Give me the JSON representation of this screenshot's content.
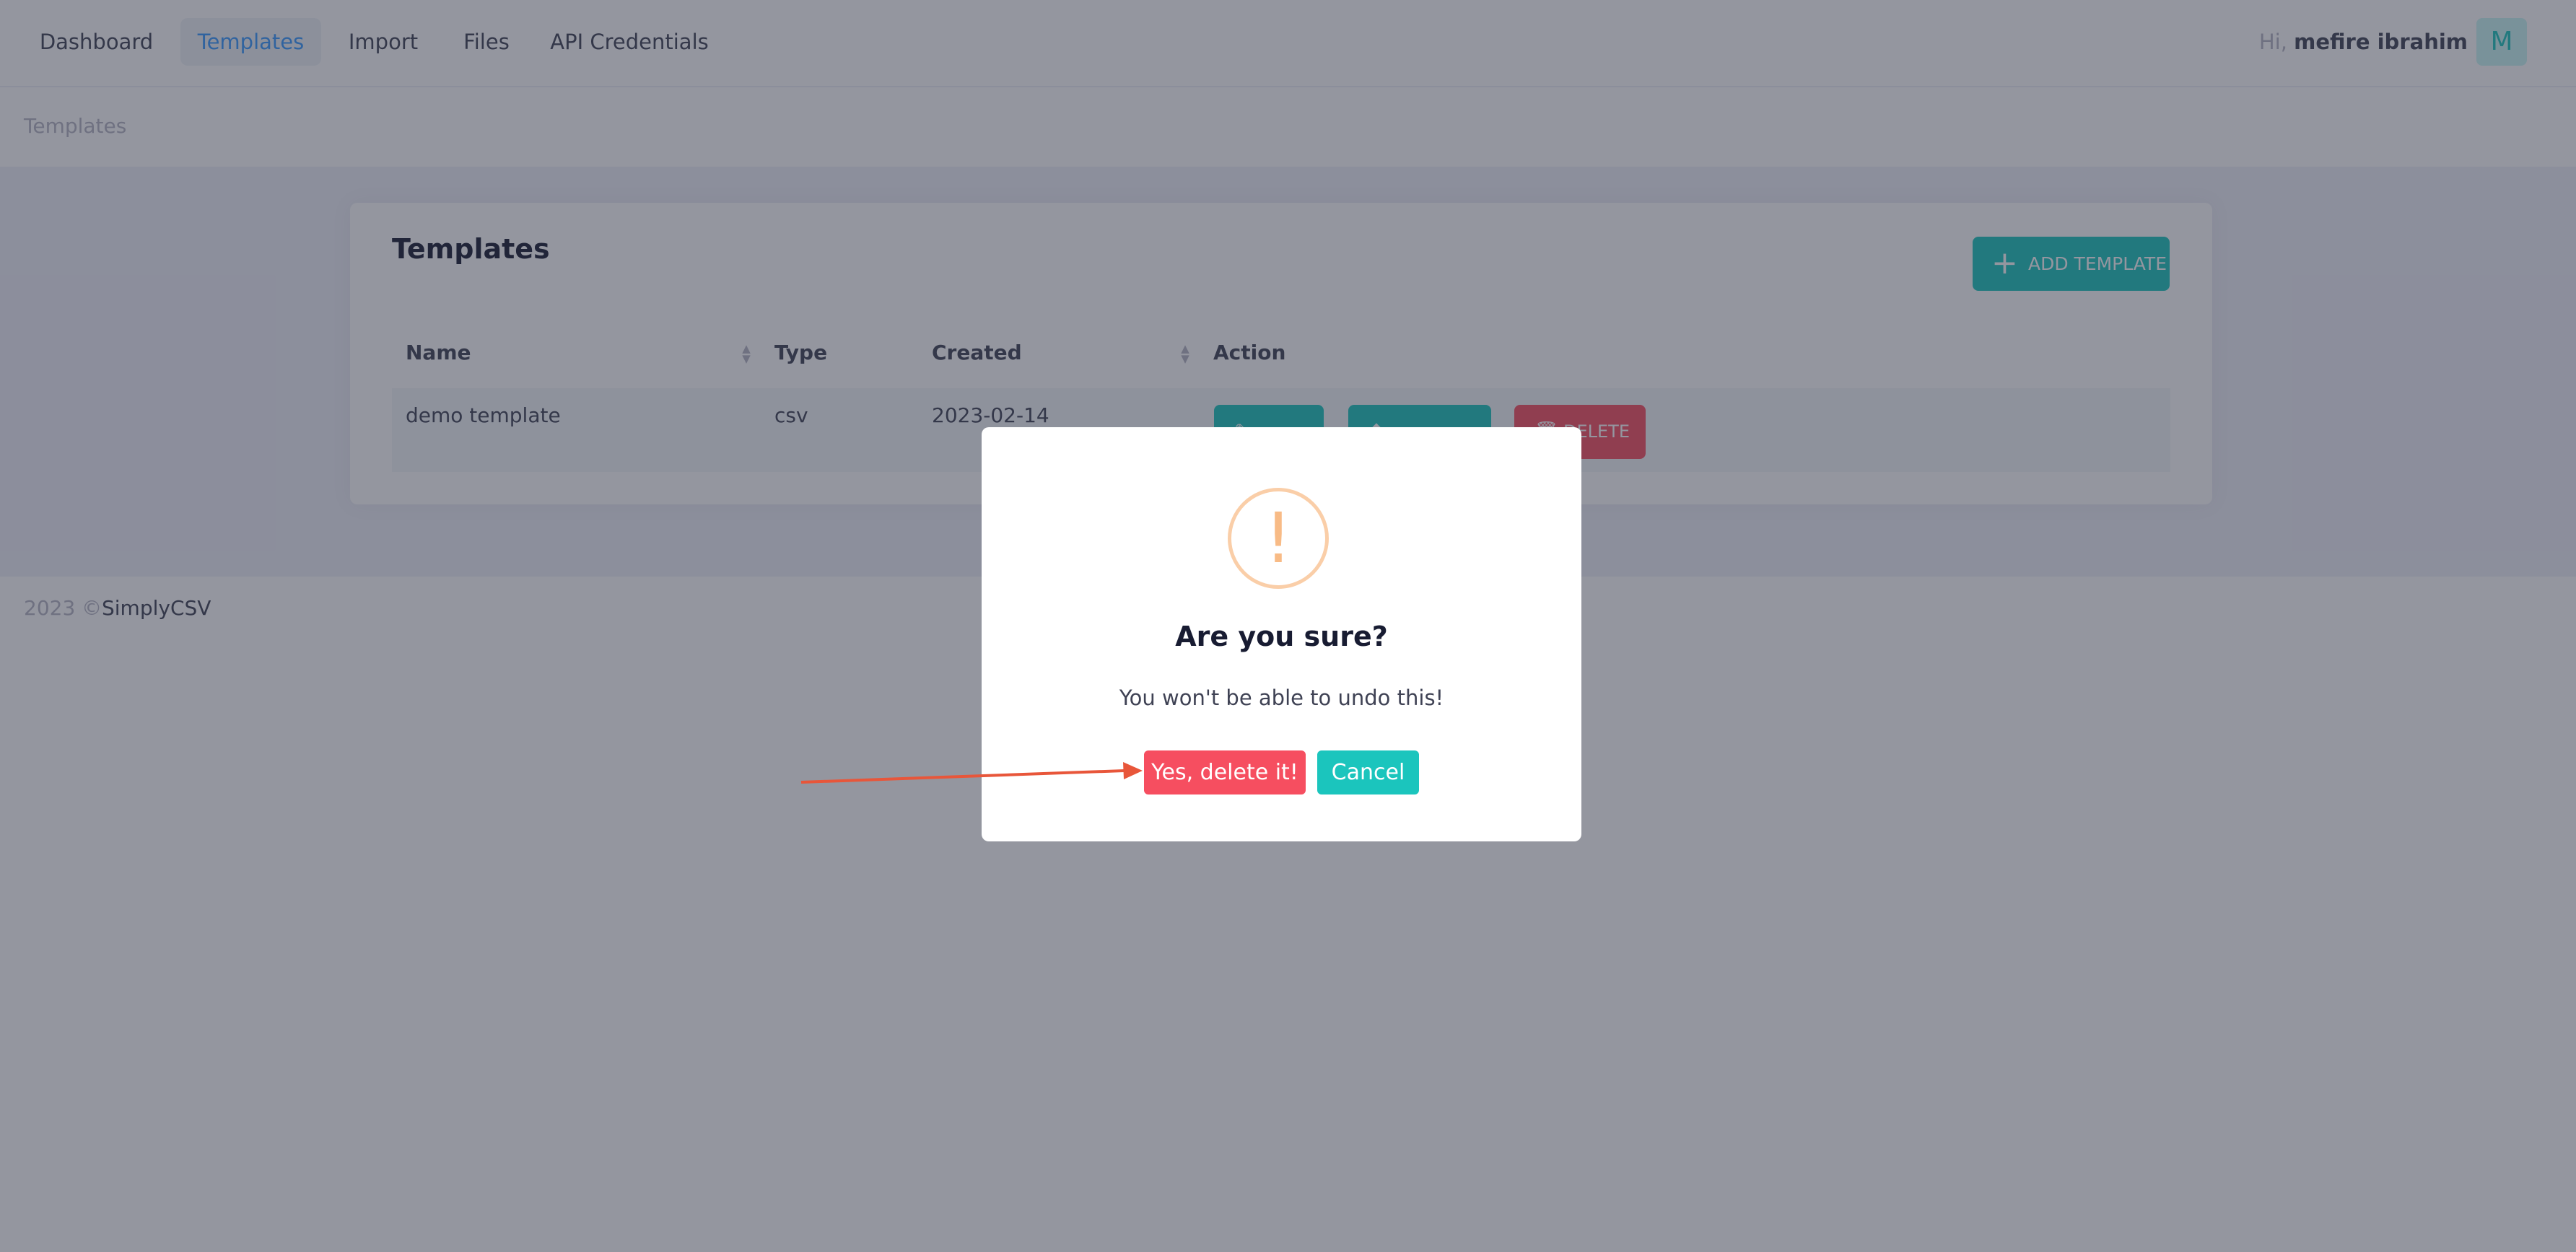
{
  "nav": {
    "items": [
      {
        "label": "Dashboard"
      },
      {
        "label": "Templates"
      },
      {
        "label": "Import"
      },
      {
        "label": "Files"
      },
      {
        "label": "API Credentials"
      }
    ],
    "active": "Templates",
    "greeting_prefix": "Hi,",
    "user_name": "mefire ibrahim",
    "avatar_initial": "M"
  },
  "breadcrumb": {
    "current": "Templates"
  },
  "templates_card": {
    "title": "Templates",
    "add_button_label": "ADD TEMPLATE",
    "add_button_icon": "plus-icon",
    "table": {
      "columns": [
        "Name",
        "Type",
        "Created",
        "Action"
      ],
      "rows": [
        {
          "name": "demo template",
          "type": "csv",
          "created": "2023-02-14"
        }
      ],
      "row_actions": {
        "delete_label": "DELETE"
      }
    }
  },
  "footer": {
    "year": "2023 ©",
    "brand": "SimplyCSV"
  },
  "dialog": {
    "icon": "warning-icon",
    "icon_glyph": "!",
    "title": "Are you sure?",
    "message": "You won't be able to undo this!",
    "confirm_label": "Yes, delete it!",
    "cancel_label": "Cancel"
  },
  "colors": {
    "primary": "#3699ff",
    "success": "#1bc5bd",
    "danger": "#f64e60",
    "warning_icon": "#f8bb86",
    "annotation_arrow": "#e8563a"
  }
}
